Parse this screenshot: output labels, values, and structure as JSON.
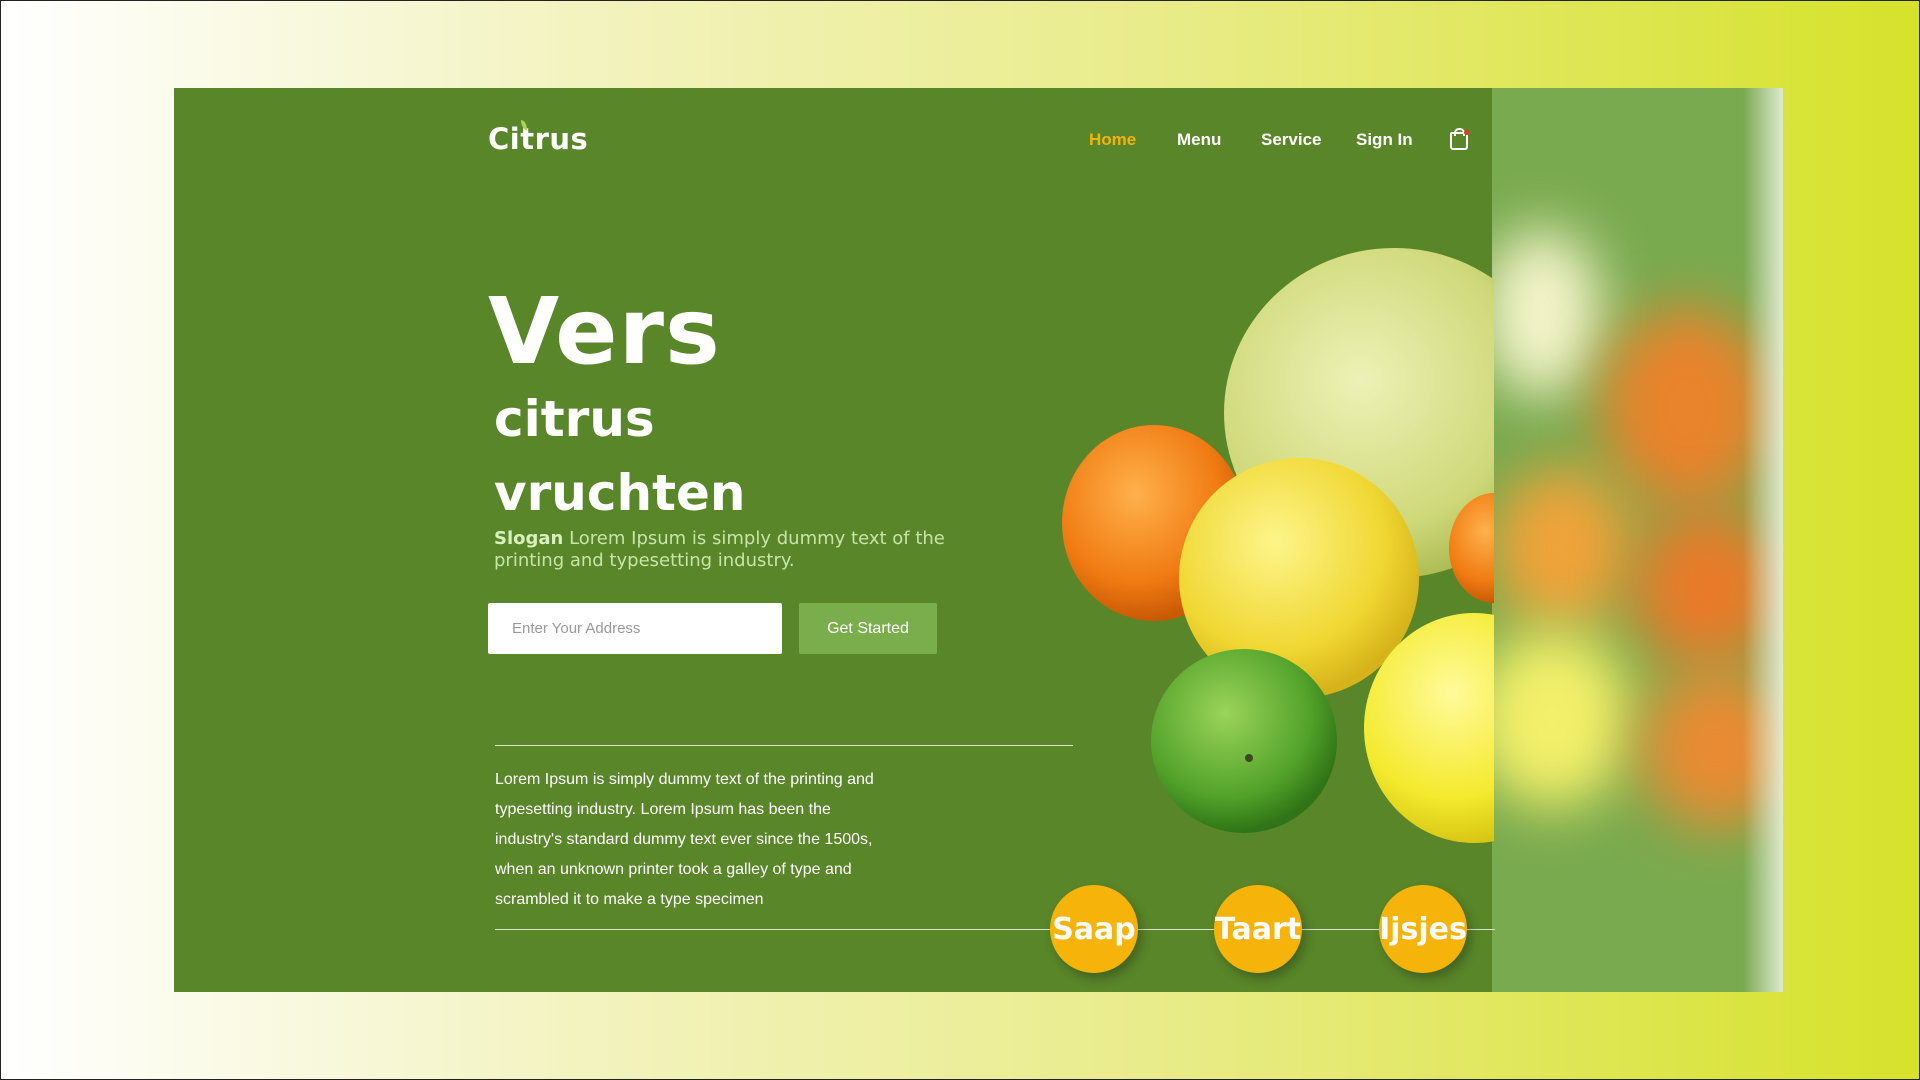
{
  "brand": {
    "name": "Citrus"
  },
  "nav": {
    "items": [
      {
        "label": "Home",
        "active": true
      },
      {
        "label": "Menu",
        "active": false
      },
      {
        "label": "Service",
        "active": false
      },
      {
        "label": "Sign In",
        "active": false
      }
    ],
    "cart_icon": "shopping-bag-icon"
  },
  "hero": {
    "line1": "Vers",
    "line2": "citrus",
    "line3": "vruchten",
    "slogan_bold": "Slogan",
    "slogan_rest": " Lorem Ipsum is simply dummy text of the printing and typesetting industry."
  },
  "signup": {
    "placeholder": "Enter Your Address",
    "value": "",
    "button_label": "Get Started"
  },
  "description": "Lorem Ipsum is simply dummy text of the printing and typesetting industry. Lorem Ipsum has been the industry's standard dummy text ever since the 1500s, when an unknown printer took a galley of type and scrambled it to make a type specimen",
  "categories": [
    {
      "label": "Saap"
    },
    {
      "label": "Taart"
    },
    {
      "label": "Ijsjes"
    }
  ],
  "colors": {
    "page_green": "#598629",
    "panel_green": "#7aaa4f",
    "accent_yellow": "#f6b40b",
    "active_nav": "#f5b30a",
    "button_green": "#7aae4c"
  }
}
